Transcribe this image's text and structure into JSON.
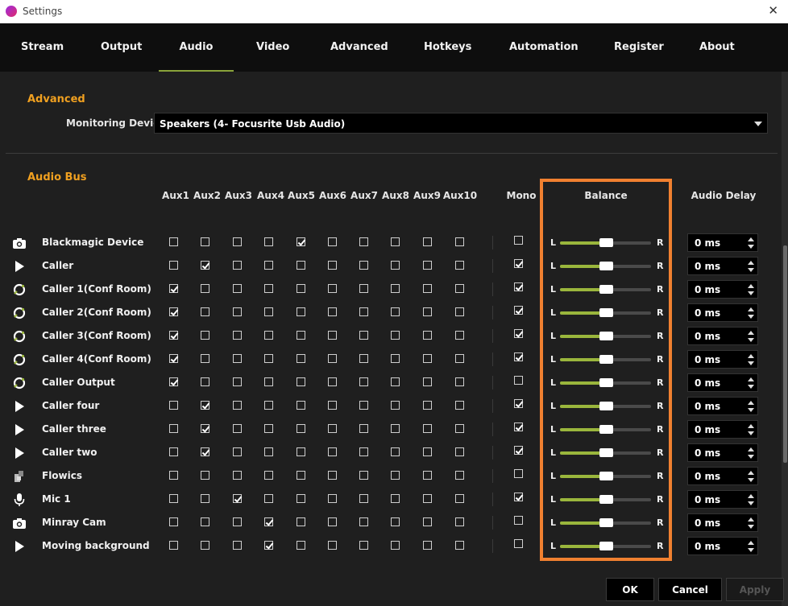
{
  "window": {
    "title": "Settings",
    "close": "✕"
  },
  "tabs": [
    "Stream",
    "Output",
    "Audio",
    "Video",
    "Advanced",
    "Hotkeys",
    "Automation",
    "Register",
    "About"
  ],
  "active_tab": "Audio",
  "advanced": {
    "section_title": "Advanced",
    "monitoring_label": "Monitoring Device",
    "monitoring_value": "Speakers (4- Focusrite Usb Audio)"
  },
  "audio_bus": {
    "section_title": "Audio Bus",
    "aux_headers": [
      "Aux1",
      "Aux2",
      "Aux3",
      "Aux4",
      "Aux5",
      "Aux6",
      "Aux7",
      "Aux8",
      "Aux9",
      "Aux10"
    ],
    "mono_header": "Mono",
    "balance_header": "Balance",
    "delay_header": "Audio Delay",
    "balance_left": "L",
    "balance_right": "R",
    "highlight_color": "#f08030",
    "rows": [
      {
        "name": "Blackmagic Device",
        "icon": "camera-icon",
        "aux": [
          false,
          false,
          false,
          false,
          true,
          false,
          false,
          false,
          false,
          false
        ],
        "mono": false,
        "balance": 0.5,
        "delay": "0 ms"
      },
      {
        "name": "Caller",
        "icon": "play-icon",
        "aux": [
          false,
          true,
          false,
          false,
          false,
          false,
          false,
          false,
          false,
          false
        ],
        "mono": true,
        "balance": 0.5,
        "delay": "0 ms"
      },
      {
        "name": "Caller 1(Conf Room)",
        "icon": "caller-link-icon",
        "aux": [
          true,
          false,
          false,
          false,
          false,
          false,
          false,
          false,
          false,
          false
        ],
        "mono": true,
        "balance": 0.5,
        "delay": "0 ms"
      },
      {
        "name": "Caller 2(Conf Room)",
        "icon": "caller-link-icon",
        "aux": [
          true,
          false,
          false,
          false,
          false,
          false,
          false,
          false,
          false,
          false
        ],
        "mono": true,
        "balance": 0.5,
        "delay": "0 ms"
      },
      {
        "name": "Caller 3(Conf Room)",
        "icon": "caller-link-icon",
        "aux": [
          true,
          false,
          false,
          false,
          false,
          false,
          false,
          false,
          false,
          false
        ],
        "mono": true,
        "balance": 0.5,
        "delay": "0 ms"
      },
      {
        "name": "Caller 4(Conf Room)",
        "icon": "caller-link-icon",
        "aux": [
          true,
          false,
          false,
          false,
          false,
          false,
          false,
          false,
          false,
          false
        ],
        "mono": true,
        "balance": 0.5,
        "delay": "0 ms"
      },
      {
        "name": "Caller Output",
        "icon": "caller-link-icon",
        "aux": [
          true,
          false,
          false,
          false,
          false,
          false,
          false,
          false,
          false,
          false
        ],
        "mono": false,
        "balance": 0.5,
        "delay": "0 ms"
      },
      {
        "name": "Caller four",
        "icon": "play-icon",
        "aux": [
          false,
          true,
          false,
          false,
          false,
          false,
          false,
          false,
          false,
          false
        ],
        "mono": true,
        "balance": 0.5,
        "delay": "0 ms"
      },
      {
        "name": "Caller three",
        "icon": "play-icon",
        "aux": [
          false,
          true,
          false,
          false,
          false,
          false,
          false,
          false,
          false,
          false
        ],
        "mono": true,
        "balance": 0.5,
        "delay": "0 ms"
      },
      {
        "name": "Caller two",
        "icon": "play-icon",
        "aux": [
          false,
          true,
          false,
          false,
          false,
          false,
          false,
          false,
          false,
          false
        ],
        "mono": true,
        "balance": 0.5,
        "delay": "0 ms"
      },
      {
        "name": "Flowics",
        "icon": "puzzle-icon",
        "aux": [
          false,
          false,
          false,
          false,
          false,
          false,
          false,
          false,
          false,
          false
        ],
        "mono": false,
        "balance": 0.5,
        "delay": "0 ms"
      },
      {
        "name": "Mic 1",
        "icon": "microphone-icon",
        "aux": [
          false,
          false,
          true,
          false,
          false,
          false,
          false,
          false,
          false,
          false
        ],
        "mono": true,
        "balance": 0.5,
        "delay": "0 ms"
      },
      {
        "name": "Minray Cam",
        "icon": "camera-icon",
        "aux": [
          false,
          false,
          false,
          true,
          false,
          false,
          false,
          false,
          false,
          false
        ],
        "mono": false,
        "balance": 0.5,
        "delay": "0 ms"
      },
      {
        "name": "Moving background",
        "icon": "play-icon",
        "aux": [
          false,
          false,
          false,
          true,
          false,
          false,
          false,
          false,
          false,
          false
        ],
        "mono": false,
        "balance": 0.5,
        "delay": "0 ms"
      }
    ]
  },
  "buttons": {
    "ok": "OK",
    "cancel": "Cancel",
    "apply": "Apply"
  }
}
